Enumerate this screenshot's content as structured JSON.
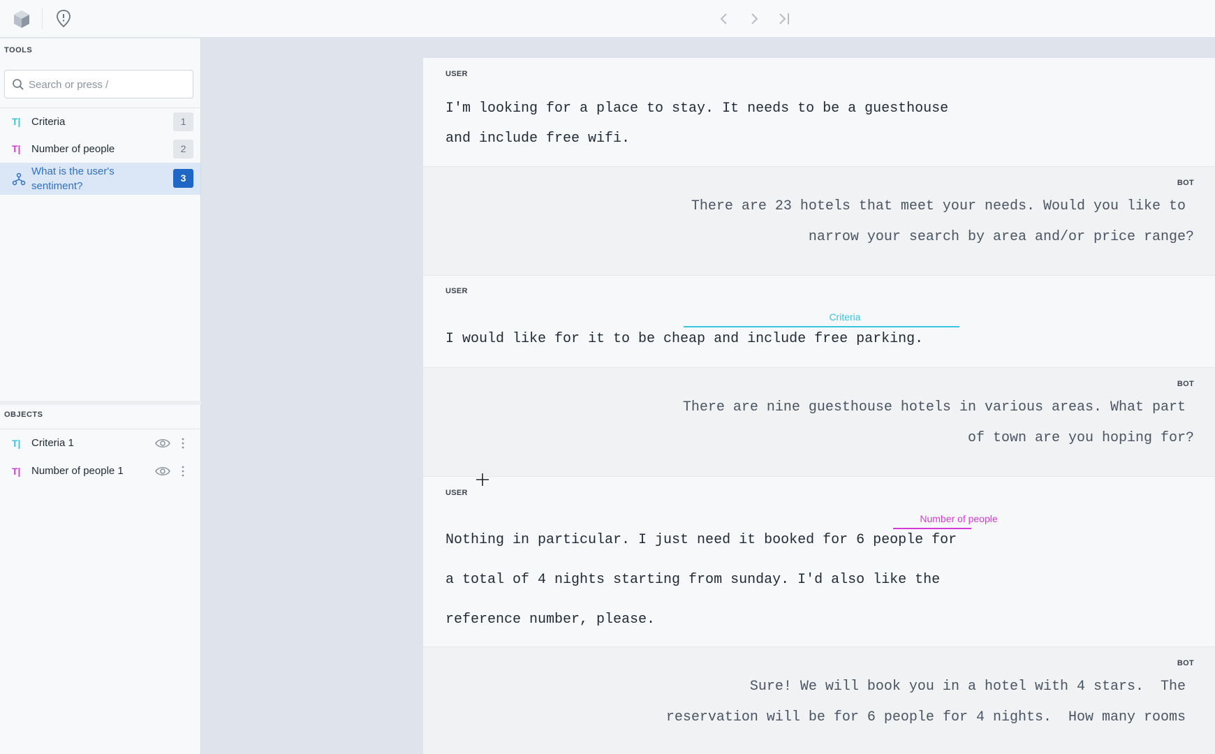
{
  "toolbar": {
    "logo_icon": "cube-logo-icon",
    "info_icon": "info-pin-icon",
    "nav": [
      "chevron-left-icon",
      "chevron-right-icon",
      "skip-to-end-icon"
    ]
  },
  "sidebar": {
    "tools_title": "TOOLS",
    "search_placeholder": "Search or press /",
    "tools": [
      {
        "label": "Criteria",
        "count": "1",
        "icon": "text-tool-icon",
        "color": "#36c6e0"
      },
      {
        "label": "Number of people",
        "count": "2",
        "icon": "text-tool-icon",
        "color": "#d63ad6"
      },
      {
        "label": "What is the user's sentiment?",
        "count": "3",
        "icon": "classification-icon",
        "active": true
      }
    ],
    "objects_title": "OBJECTS",
    "objects": [
      {
        "label": "Criteria 1",
        "color": "#36c6e0"
      },
      {
        "label": "Number of people 1",
        "color": "#d63ad6"
      }
    ]
  },
  "conversation": [
    {
      "role": "USER",
      "lines": [
        "I'm looking for a place to stay. It needs to be a guesthouse",
        "and include free wifi."
      ]
    },
    {
      "role": "BOT",
      "lines": [
        "There are 23 hotels that meet your needs. Would you like to",
        "narrow your search by area and/or price range?"
      ]
    },
    {
      "role": "USER",
      "lines": [
        "I would like for it to be cheap and include free parking."
      ],
      "annotation": {
        "label": "Criteria",
        "color": "#36c6e0"
      }
    },
    {
      "role": "BOT",
      "lines": [
        "There are nine guesthouse hotels in various areas. What part",
        "of town are you hoping for?"
      ]
    },
    {
      "role": "USER",
      "lines": [
        "Nothing in particular. I just need it booked for 6 people for",
        "a total of 4 nights starting from sunday. I'd also like the",
        "reference number, please."
      ],
      "annotation": {
        "label": "Number of people",
        "color": "#d63ad6"
      }
    },
    {
      "role": "BOT",
      "lines": [
        "Sure! We will book you in a hotel with 4 stars.  The",
        "reservation will be for 6 people for 4 nights.  How many rooms"
      ]
    }
  ]
}
